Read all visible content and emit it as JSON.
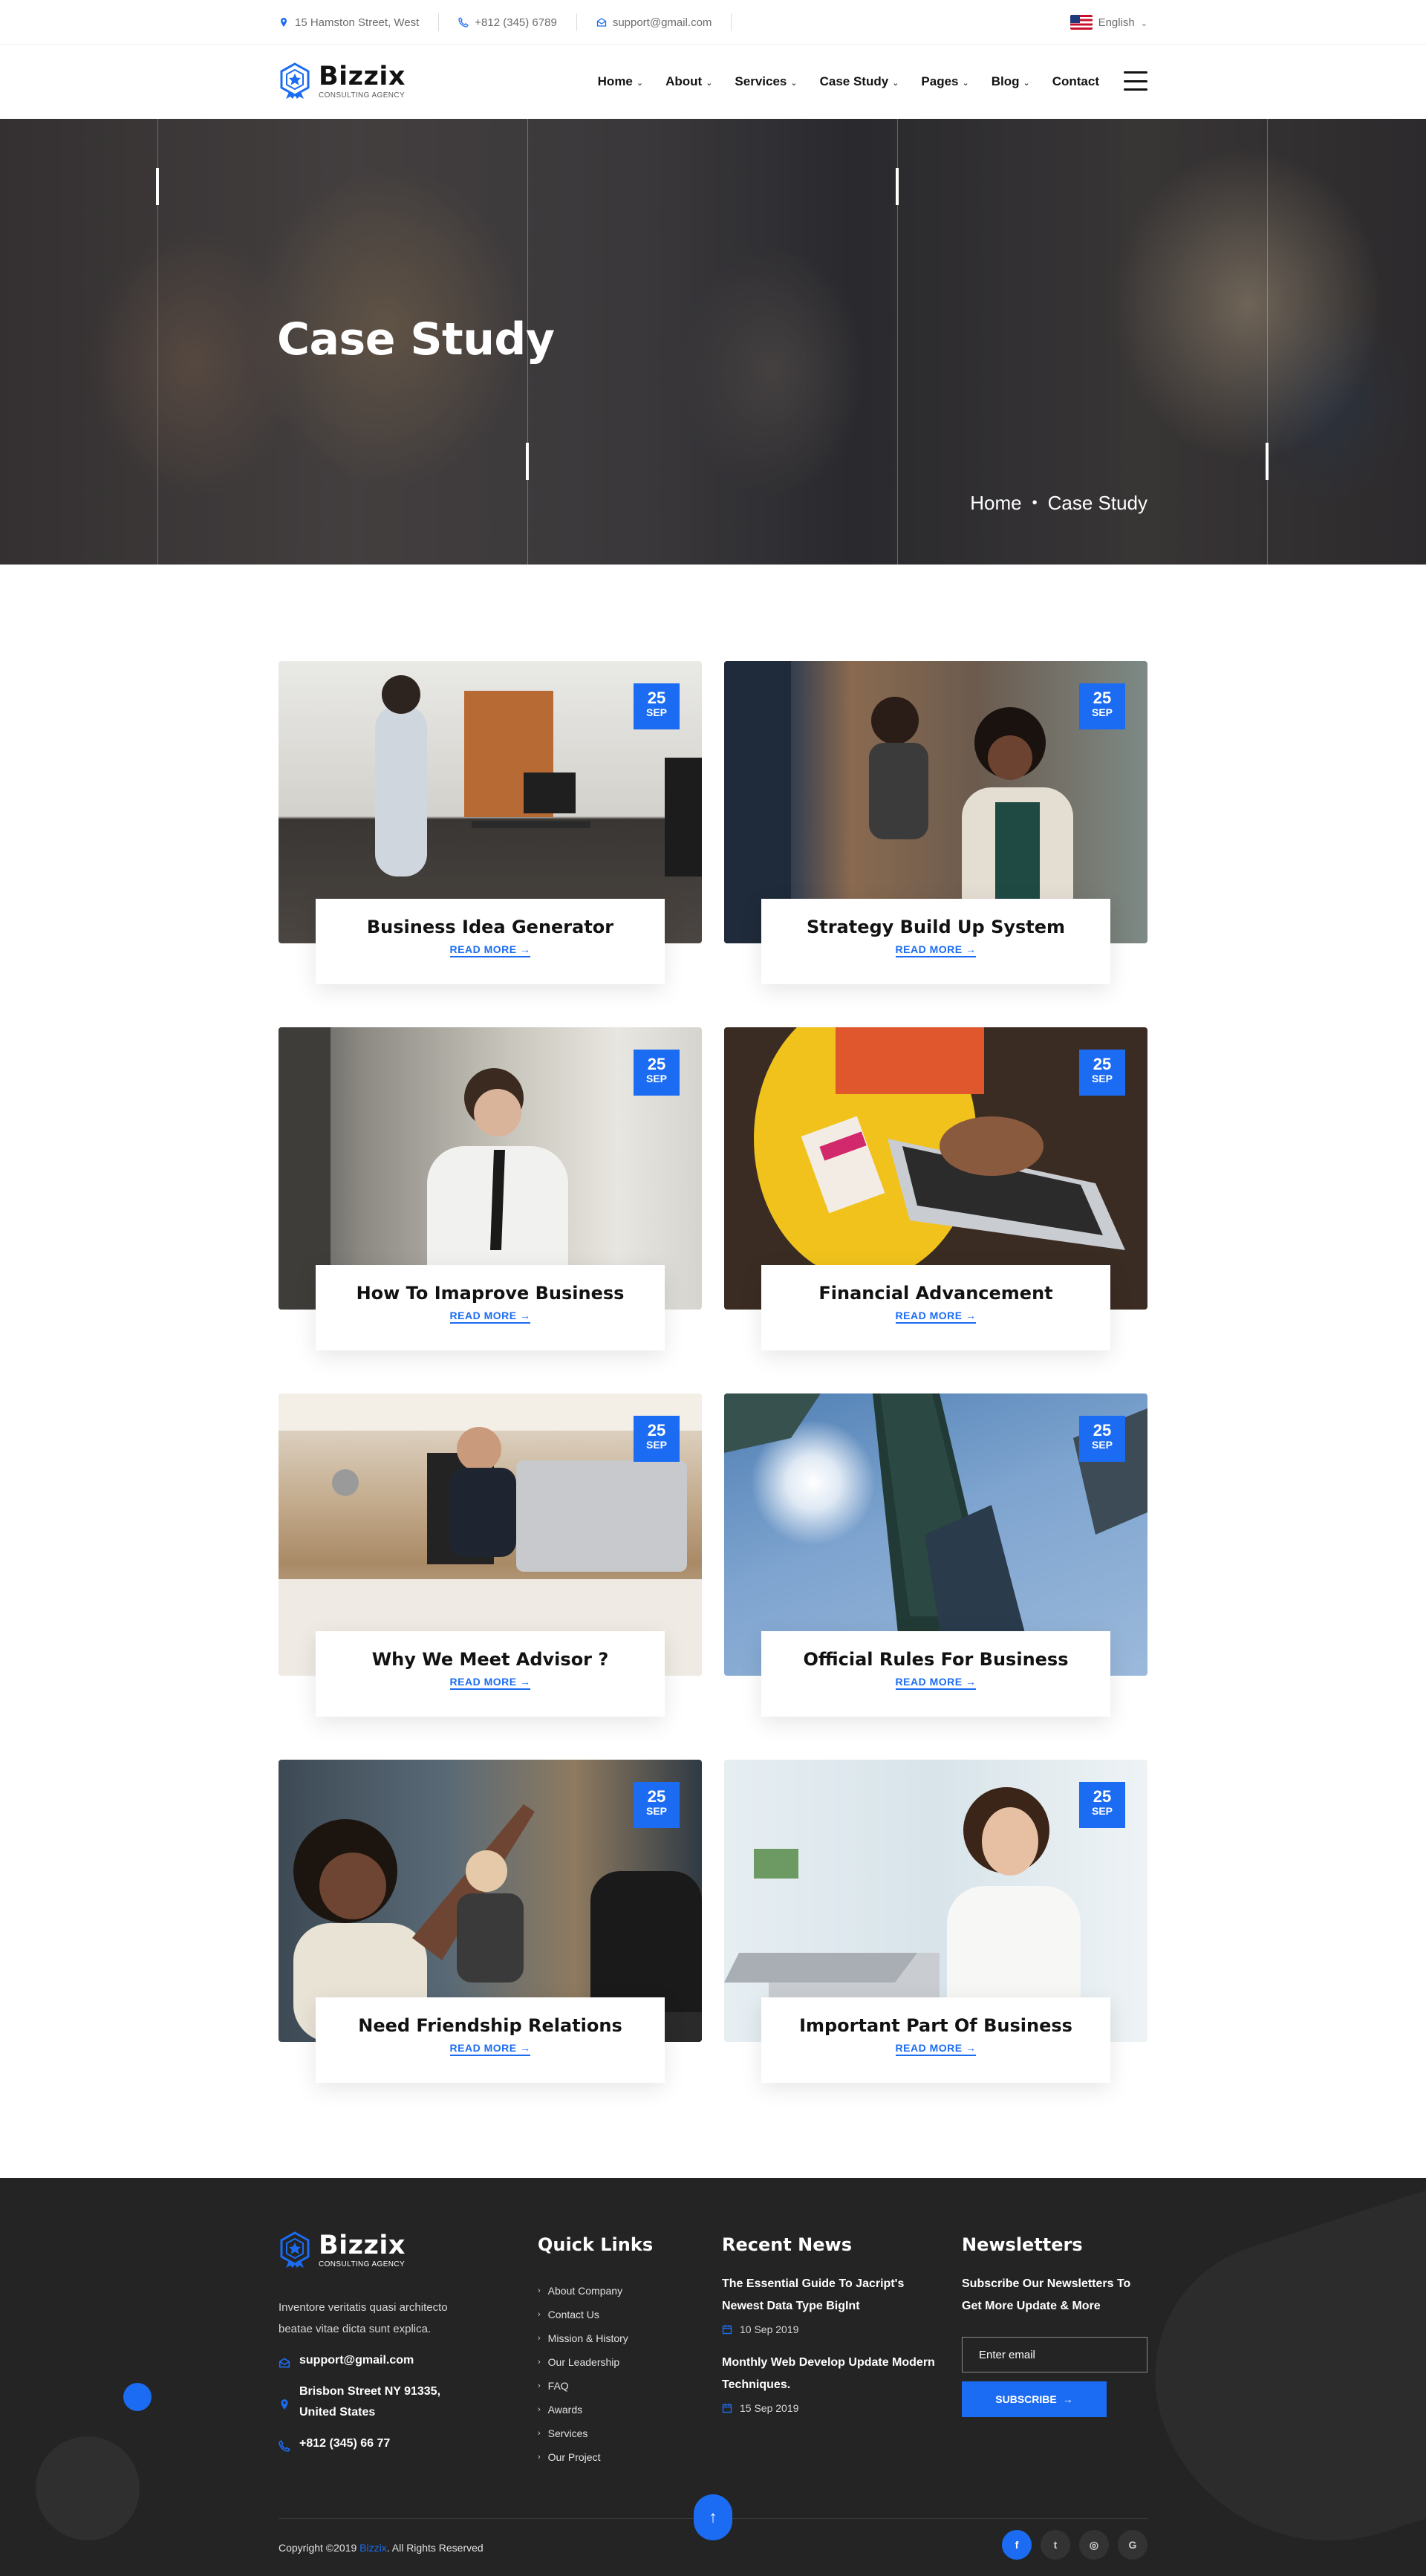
{
  "topbar": {
    "address": "15 Hamston Street, West",
    "phone": "+812 (345) 6789",
    "email": "support@gmail.com",
    "language": "English",
    "icons": [
      "location-pin-icon",
      "phone-icon",
      "mail-icon",
      "us-flag-icon",
      "chevron-down-icon"
    ]
  },
  "brand": {
    "name": "Bizzix",
    "tagline": "Consulting Agency",
    "accent": "#1b6cf2"
  },
  "nav": {
    "items": [
      {
        "label": "Home",
        "dropdown": true
      },
      {
        "label": "About",
        "dropdown": true
      },
      {
        "label": "Services",
        "dropdown": true
      },
      {
        "label": "Case Study",
        "dropdown": true
      },
      {
        "label": "Pages",
        "dropdown": true
      },
      {
        "label": "Blog",
        "dropdown": true
      },
      {
        "label": "Contact",
        "dropdown": false
      }
    ],
    "menu_icon": "hamburger-icon"
  },
  "hero": {
    "title": "Case Study",
    "breadcrumb": [
      "Home",
      "Case Study"
    ],
    "breadcrumb_separator": "•"
  },
  "cases": [
    {
      "day": "25",
      "month": "SEP",
      "title": "Business Idea Generator",
      "link": "READ MORE"
    },
    {
      "day": "25",
      "month": "SEP",
      "title": "Strategy Build Up System",
      "link": "READ MORE"
    },
    {
      "day": "25",
      "month": "SEP",
      "title": "How To Imaprove Business",
      "link": "READ MORE"
    },
    {
      "day": "25",
      "month": "SEP",
      "title": "Financial Advancement",
      "link": "READ MORE"
    },
    {
      "day": "25",
      "month": "SEP",
      "title": "Why We Meet Advisor ?",
      "link": "READ MORE"
    },
    {
      "day": "25",
      "month": "SEP",
      "title": "Official Rules For Business",
      "link": "READ MORE"
    },
    {
      "day": "25",
      "month": "SEP",
      "title": "Need Friendship Relations",
      "link": "READ MORE"
    },
    {
      "day": "25",
      "month": "SEP",
      "title": "Important Part Of Business",
      "link": "READ MORE"
    }
  ],
  "footer": {
    "about": "Inventore veritatis quasi architecto beatae vitae dicta sunt explica.",
    "email": "support@gmail.com",
    "address": "Brisbon Street NY 91335, United States",
    "phone": "+812 (345) 66 77",
    "quick_links_title": "Quick Links",
    "quick_links": [
      "About Company",
      "Contact Us",
      "Mission & History",
      "Our Leadership",
      "FAQ",
      "Awards",
      "Services",
      "Our Project"
    ],
    "news_title": "Recent News",
    "news": [
      {
        "title": "The Essential Guide To Jacript's Newest Data Type BigInt",
        "date": "10 Sep 2019"
      },
      {
        "title": "Monthly Web Develop Update Modern Techniques.",
        "date": "15 Sep 2019"
      }
    ],
    "newsletter_title": "Newsletters",
    "newsletter_text": "Subscribe Our Newsletters To Get More Update & More",
    "newsletter_placeholder": "Enter email",
    "subscribe_label": "SUBSCRIBE",
    "copyright_prefix": "Copyright ©2019",
    "copyright_brand": "Bizzix",
    "copyright_suffix": ". All Rights Reserved",
    "socials": [
      {
        "icon": "facebook-icon",
        "glyph": "f",
        "active": true
      },
      {
        "icon": "twitter-icon",
        "glyph": "t",
        "active": false
      },
      {
        "icon": "instagram-icon",
        "glyph": "◎",
        "active": false
      },
      {
        "icon": "google-icon",
        "glyph": "G",
        "active": false
      }
    ]
  }
}
